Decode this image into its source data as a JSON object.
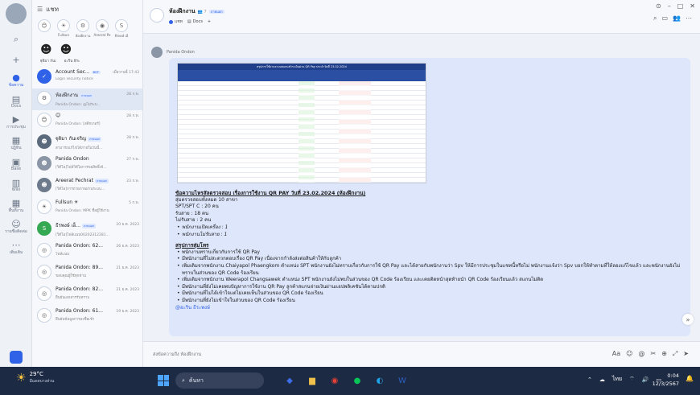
{
  "window": {
    "controls": [
      "⊙",
      "–",
      "□",
      "✕"
    ]
  },
  "rail": {
    "items": [
      {
        "icon": "search-icon",
        "glyph": "⌕",
        "label": ""
      },
      {
        "icon": "add-icon",
        "glyph": "+",
        "label": ""
      },
      {
        "icon": "chat-icon",
        "glyph": "●",
        "label": "ข้อความ"
      },
      {
        "icon": "docs-icon",
        "glyph": "▤",
        "label": "Docs"
      },
      {
        "icon": "meeting-icon",
        "glyph": "▶",
        "label": "การประชุม"
      },
      {
        "icon": "calendar-icon",
        "glyph": "▦",
        "label": "ปฏิทิน"
      },
      {
        "icon": "base-icon",
        "glyph": "▣",
        "label": "Base"
      },
      {
        "icon": "wiki-icon",
        "glyph": "▥",
        "label": "Wiki"
      },
      {
        "icon": "workspace-icon",
        "glyph": "▦",
        "label": "พื้นที่งาน"
      },
      {
        "icon": "contacts-icon",
        "glyph": "☺",
        "label": "รายชื่อติดต่อ"
      },
      {
        "icon": "more-icon",
        "glyph": "⋯",
        "label": "เพิ่มเติม"
      }
    ]
  },
  "list": {
    "header": "แชท",
    "stories": [
      {
        "label": "",
        "glyph": "😊"
      },
      {
        "label": "Fullsun",
        "glyph": "☀"
      },
      {
        "label": "ห้องฝึกงาน",
        "glyph": "⚙"
      },
      {
        "label": "Areerat Pe",
        "glyph": "◉"
      },
      {
        "label": "ธีรพงษ์ เอ็",
        "glyph": "S"
      }
    ],
    "pinned_names": [
      "ฐุติมา กันเ",
      "อะริน ธีระ"
    ],
    "conversations": [
      {
        "name": "Account Sec...",
        "badge": "BOT",
        "time": "เมื่อวานนี้ 17:43",
        "preview": "Login security notice",
        "color": "#2f62e6",
        "glyph": "✓",
        "selected": false
      },
      {
        "name": "ห้องฝึกงาน",
        "badge": "ภายนอก",
        "time": "28 ก.พ.",
        "preview": "Panida Ondon: @ไม่ระบ...",
        "color": "#ffffff",
        "glyph": "⚙",
        "selected": true
      },
      {
        "name": "😊",
        "badge": "",
        "time": "28 ก.พ.",
        "preview": "Panida Ondon: [สติกเกอร์]",
        "color": "#ffffff",
        "glyph": "😊",
        "selected": false
      },
      {
        "name": "ฐุติมา กันเจริญ",
        "badge": "ภายนอก",
        "time": "28 ก.พ.",
        "preview": "สามารถแก้ไขได้ภายในวันนี้...",
        "color": "#5b6b7d",
        "glyph": "☻",
        "selected": false
      },
      {
        "name": "Panida Ondon",
        "badge": "",
        "time": "27 ก.พ.",
        "preview": "[วิดีโอ]ไฟล์วิดีโอการขอสิทธิ์เข้...",
        "color": "#8a95a5",
        "glyph": "☻",
        "selected": false
      },
      {
        "name": "Areerat Pechrat",
        "badge": "ภายนอก",
        "time": "23 ก.พ.",
        "preview": "[วิดีโอ]การถ่ายภาพผ่านระบบ...",
        "color": "#6c7a8c",
        "glyph": "☻",
        "selected": false
      },
      {
        "name": "Fullsun ☀",
        "badge": "",
        "time": "5 ก.พ.",
        "preview": "Panida Ondon: MPK ชื่อผู้ใช้งาน",
        "color": "#ffffff",
        "glyph": "☀",
        "selected": false
      },
      {
        "name": "ธีรพงษ์ เอ็...",
        "badge": "ภายนอก",
        "time": "20 ธ.ค. 2023",
        "preview": "[วิดีโอ]ไฟล์แนบ00202312281...",
        "color": "#35a853",
        "glyph": "S",
        "selected": false
      },
      {
        "name": "Panida Ondon: 62...",
        "badge": "",
        "time": "26 ธ.ค. 2023",
        "preview": "ไฟล์แนบ",
        "color": "#ffffff",
        "glyph": "◎",
        "selected": false
      },
      {
        "name": "Panida Ondon: 89...",
        "badge": "",
        "time": "21 ธ.ค. 2023",
        "preview": "ขอบคุณผู้ใช้ทุกท่าน",
        "color": "#ffffff",
        "glyph": "◎",
        "selected": false
      },
      {
        "name": "Panida Ondon: 82...",
        "badge": "",
        "time": "21 ธ.ค. 2023",
        "preview": "ยืนยันเอกสารรับทราบ",
        "color": "#ffffff",
        "glyph": "◎",
        "selected": false
      },
      {
        "name": "Panida Ondon: 61...",
        "badge": "",
        "time": "19 ธ.ค. 2023",
        "preview": "ยืนยันข้อมูลการลงชื่อเข้า",
        "color": "#ffffff",
        "glyph": "◎",
        "selected": false
      }
    ]
  },
  "chat": {
    "title": "ห้องฝึกงาน",
    "member_count": "👥 7",
    "tag": "ภายนอก",
    "tabs": [
      "แชท",
      "Docs",
      "+"
    ],
    "header_icons": [
      "⌕",
      "▭",
      "👥",
      "⋯"
    ],
    "sender": "Panida Ondon",
    "sheet_title": "สรุปการใช้งานระบบสแกนชำระเงินผ่าน QR Pay ประจำวันที่ 23.02.2024",
    "message": {
      "heading": "ข้อความไหรสัลตรวจสอบ เรื่องการใช้งาน QR PAY วันที่ 23.02.2024 (ห้องฝึกงาน)",
      "lines": [
        "สุ่มตรวจสอบทั้งหมด 10 สาขา",
        "SPT/SPT C : 20 คน",
        "รับสาย : 18 คน",
        "ไม่รับสาย : 2 คน"
      ],
      "italic_lines": [
        "พนักงานเปิดเครื่อง : 1",
        "พนักงานไม่รับสาย : 1"
      ],
      "summary_heading": "สรุปการสุ่มโทร",
      "bullets": [
        "พนักงานทราบเกี่ยวกับการใช้ QR Pay",
        "มีพนักงานที่ไม่สะดวกตอบเรื่อง QR Pay เนื่องจากกำลังส่งต่อสินค้าให้กับลูกค้า",
        "เพิ่มเติมจากพนักงาน Chaiyapol Phaengkom ตำแหน่ง SPT พนักงานยังไม่ทราบเกี่ยวกับการใช้ QR Pay และได้สายกับพนักงานว่า Spv ให้มีการประชุมในแชทนี้หรือไม่ พนักงานแจ้งว่า Spv บอกให้ทำตามที่ให้ลองแก้ไขแล้ว และพนักงานยังไม่ทราบในส่วนของ QR Code ร้องเรียน",
        "เพิ่มเติมจากพนักงาน Weerapol Changsawek ตำแหน่ง SPT พนักงานยังไม่พบในส่วนของ QR Code ร้องเรียน และเคยติดหน้าสุดท้ายนำ QR Code ร้องเรียนแล้ว สแกนไม่ติด",
        "มีพนักงานที่ยังไม่เคยพบปัญหาการใช้งาน QR Pay ลูกค้าสแกนจ่ายเงินผ่านแอปพลิเคชันได้ตามปกติ",
        "มีพนักงานที่ไม่ได้เข้าใจแต่ไม่เคยเห็นในส่วนของ QR Code ร้องเรียน",
        "มีพนักงานที่ยังไม่เข้าใจในส่วนของ QR Code ร้องเรียน"
      ],
      "mention": "@อะริน ธีระพงษ์"
    },
    "composer_placeholder": "ส่งข้อความถึง ห้องฝึกงาน",
    "composer_tools": [
      "Aa",
      "☺",
      "@",
      "✂",
      "⊕",
      "⤢",
      "➤"
    ]
  },
  "taskbar": {
    "temperature": "29°C",
    "weather_text": "มีแดดบางส่วน",
    "search_placeholder": "ค้นหา",
    "apps": [
      {
        "icon": "lark-icon",
        "glyph": "◆",
        "color": "#3b6fe8"
      },
      {
        "icon": "files-icon",
        "glyph": "▆",
        "color": "#f0c24b"
      },
      {
        "icon": "chrome-icon",
        "glyph": "◉",
        "color": "#e94235"
      },
      {
        "icon": "line-icon",
        "glyph": "●",
        "color": "#06c755"
      },
      {
        "icon": "edge-icon",
        "glyph": "◐",
        "color": "#1fa3e8"
      },
      {
        "icon": "word-icon",
        "glyph": "W",
        "color": "#2b5fc0"
      }
    ],
    "tray": [
      "⌃",
      "☁",
      "ไทย",
      "⌔",
      "🔊",
      "▭"
    ],
    "time": "0:04",
    "date": "12/3/2567"
  }
}
